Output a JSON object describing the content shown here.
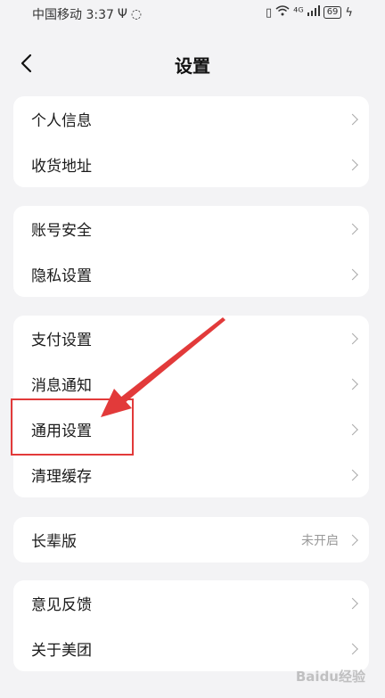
{
  "status_bar": {
    "carrier_time": "中国移动 3:37",
    "signal_text": "⁴ᴳ",
    "battery": "69"
  },
  "header": {
    "title": "设置"
  },
  "groups": [
    {
      "items": [
        {
          "label": "个人信息"
        },
        {
          "label": "收货地址"
        }
      ]
    },
    {
      "items": [
        {
          "label": "账号安全"
        },
        {
          "label": "隐私设置"
        }
      ]
    },
    {
      "items": [
        {
          "label": "支付设置"
        },
        {
          "label": "消息通知"
        },
        {
          "label": "通用设置"
        },
        {
          "label": "清理缓存"
        }
      ]
    },
    {
      "items": [
        {
          "label": "长辈版",
          "value": "未开启"
        }
      ]
    },
    {
      "items": [
        {
          "label": "意见反馈"
        },
        {
          "label": "关于美团"
        }
      ]
    }
  ],
  "annotation": {
    "color": "#e23a3a",
    "highlighted_item": "通用设置"
  },
  "watermark": "Baidu经验"
}
